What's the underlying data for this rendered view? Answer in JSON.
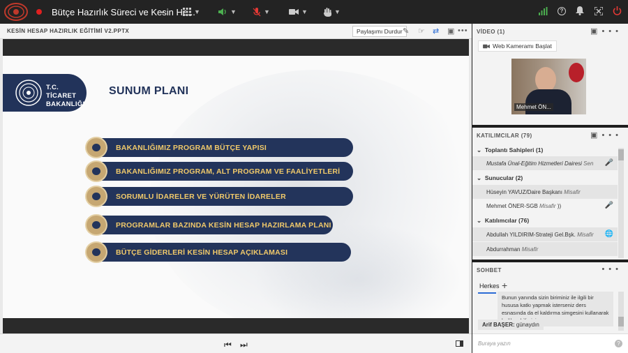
{
  "topbar": {
    "title": "Bütçe Hazırlık Süreci ve Kesin He...",
    "icons": {
      "logo": "ministry-logo",
      "recording": "record-dot-icon",
      "chevron": "chevron-down-icon",
      "apps": "grid-icon",
      "audio": "speaker-icon",
      "mic": "microphone-muted-icon",
      "camera": "camera-icon",
      "raise_hand": "raise-hand-icon",
      "signal": "signal-bars-icon",
      "help": "help-icon",
      "notifications": "bell-icon",
      "fullscreen": "fullscreen-icon",
      "power": "power-icon"
    },
    "colors": {
      "signal": "#4caf50",
      "audio": "#4caf50",
      "mic": "#e53935",
      "power": "#e53935",
      "record": "#e02020"
    }
  },
  "share": {
    "doc_title": "KESİN HESAP HAZIRLIK EĞİTİMİ V2.PPTX",
    "stop_label": "Paylaşımı Durdur"
  },
  "slide": {
    "logo_line1": "T.C. TİCARET",
    "logo_line2": "BAKANLIĞI",
    "title": "SUNUM PLANI",
    "items": [
      "BAKANLIĞIMIZ PROGRAM BÜTÇE YAPISI",
      "BAKANLIĞIMIZ PROGRAM, ALT PROGRAM VE FAALİYETLERİ",
      "SORUMLU İDARELER VE YÜRÜTEN İDARELER",
      "PROGRAMLAR BAZINDA KESİN HESAP HAZIRLAMA PLANI",
      "BÜTÇE GİDERLERİ KESİN HESAP AÇIKLAMASI"
    ],
    "colors": {
      "navy": "#23345b",
      "gold": "#c6a772",
      "text": "#f0c96a"
    }
  },
  "video": {
    "header": "VİDEO",
    "count": "(1)",
    "start_camera": "Web Kameramı Başlat",
    "participant_name": "Mehmet ÖN..."
  },
  "participants": {
    "header": "KATILIMCILAR",
    "count": "(79)",
    "hosts_label": "Toplantı Sahipleri (1)",
    "hosts": [
      {
        "name": "Mustafa Ünal-Eğitim Hizmetleri Dairesi",
        "role": "Sen"
      }
    ],
    "presenters_label": "Sunucular (2)",
    "presenters": [
      {
        "name": "Hüseyin YAVUZ/Daire Başkanı",
        "role": "Misafir"
      },
      {
        "name": "Mehmet ÖNER-SGB",
        "role": "Misafir"
      }
    ],
    "attendees_label": "Katılımcılar (76)",
    "attendees": [
      {
        "name": "Abdullah YILDIRIM-Strateji Gel.Bşk.",
        "role": "Misafir"
      },
      {
        "name": "Abdurrahman",
        "role": "Misafir"
      }
    ]
  },
  "chat": {
    "header": "SOHBET",
    "tab_label": "Herkes",
    "message_text": "Bunun yanında sizin biriminiz ile ilgili bir hususa katkı yapmak isterseniz ders esnasında da el kaldırma simgesini kullanarak bağlanabilirsiniz.",
    "last_sender": "Arif BAŞER:",
    "last_text": "günaydın",
    "input_placeholder": "Buraya yazın"
  }
}
